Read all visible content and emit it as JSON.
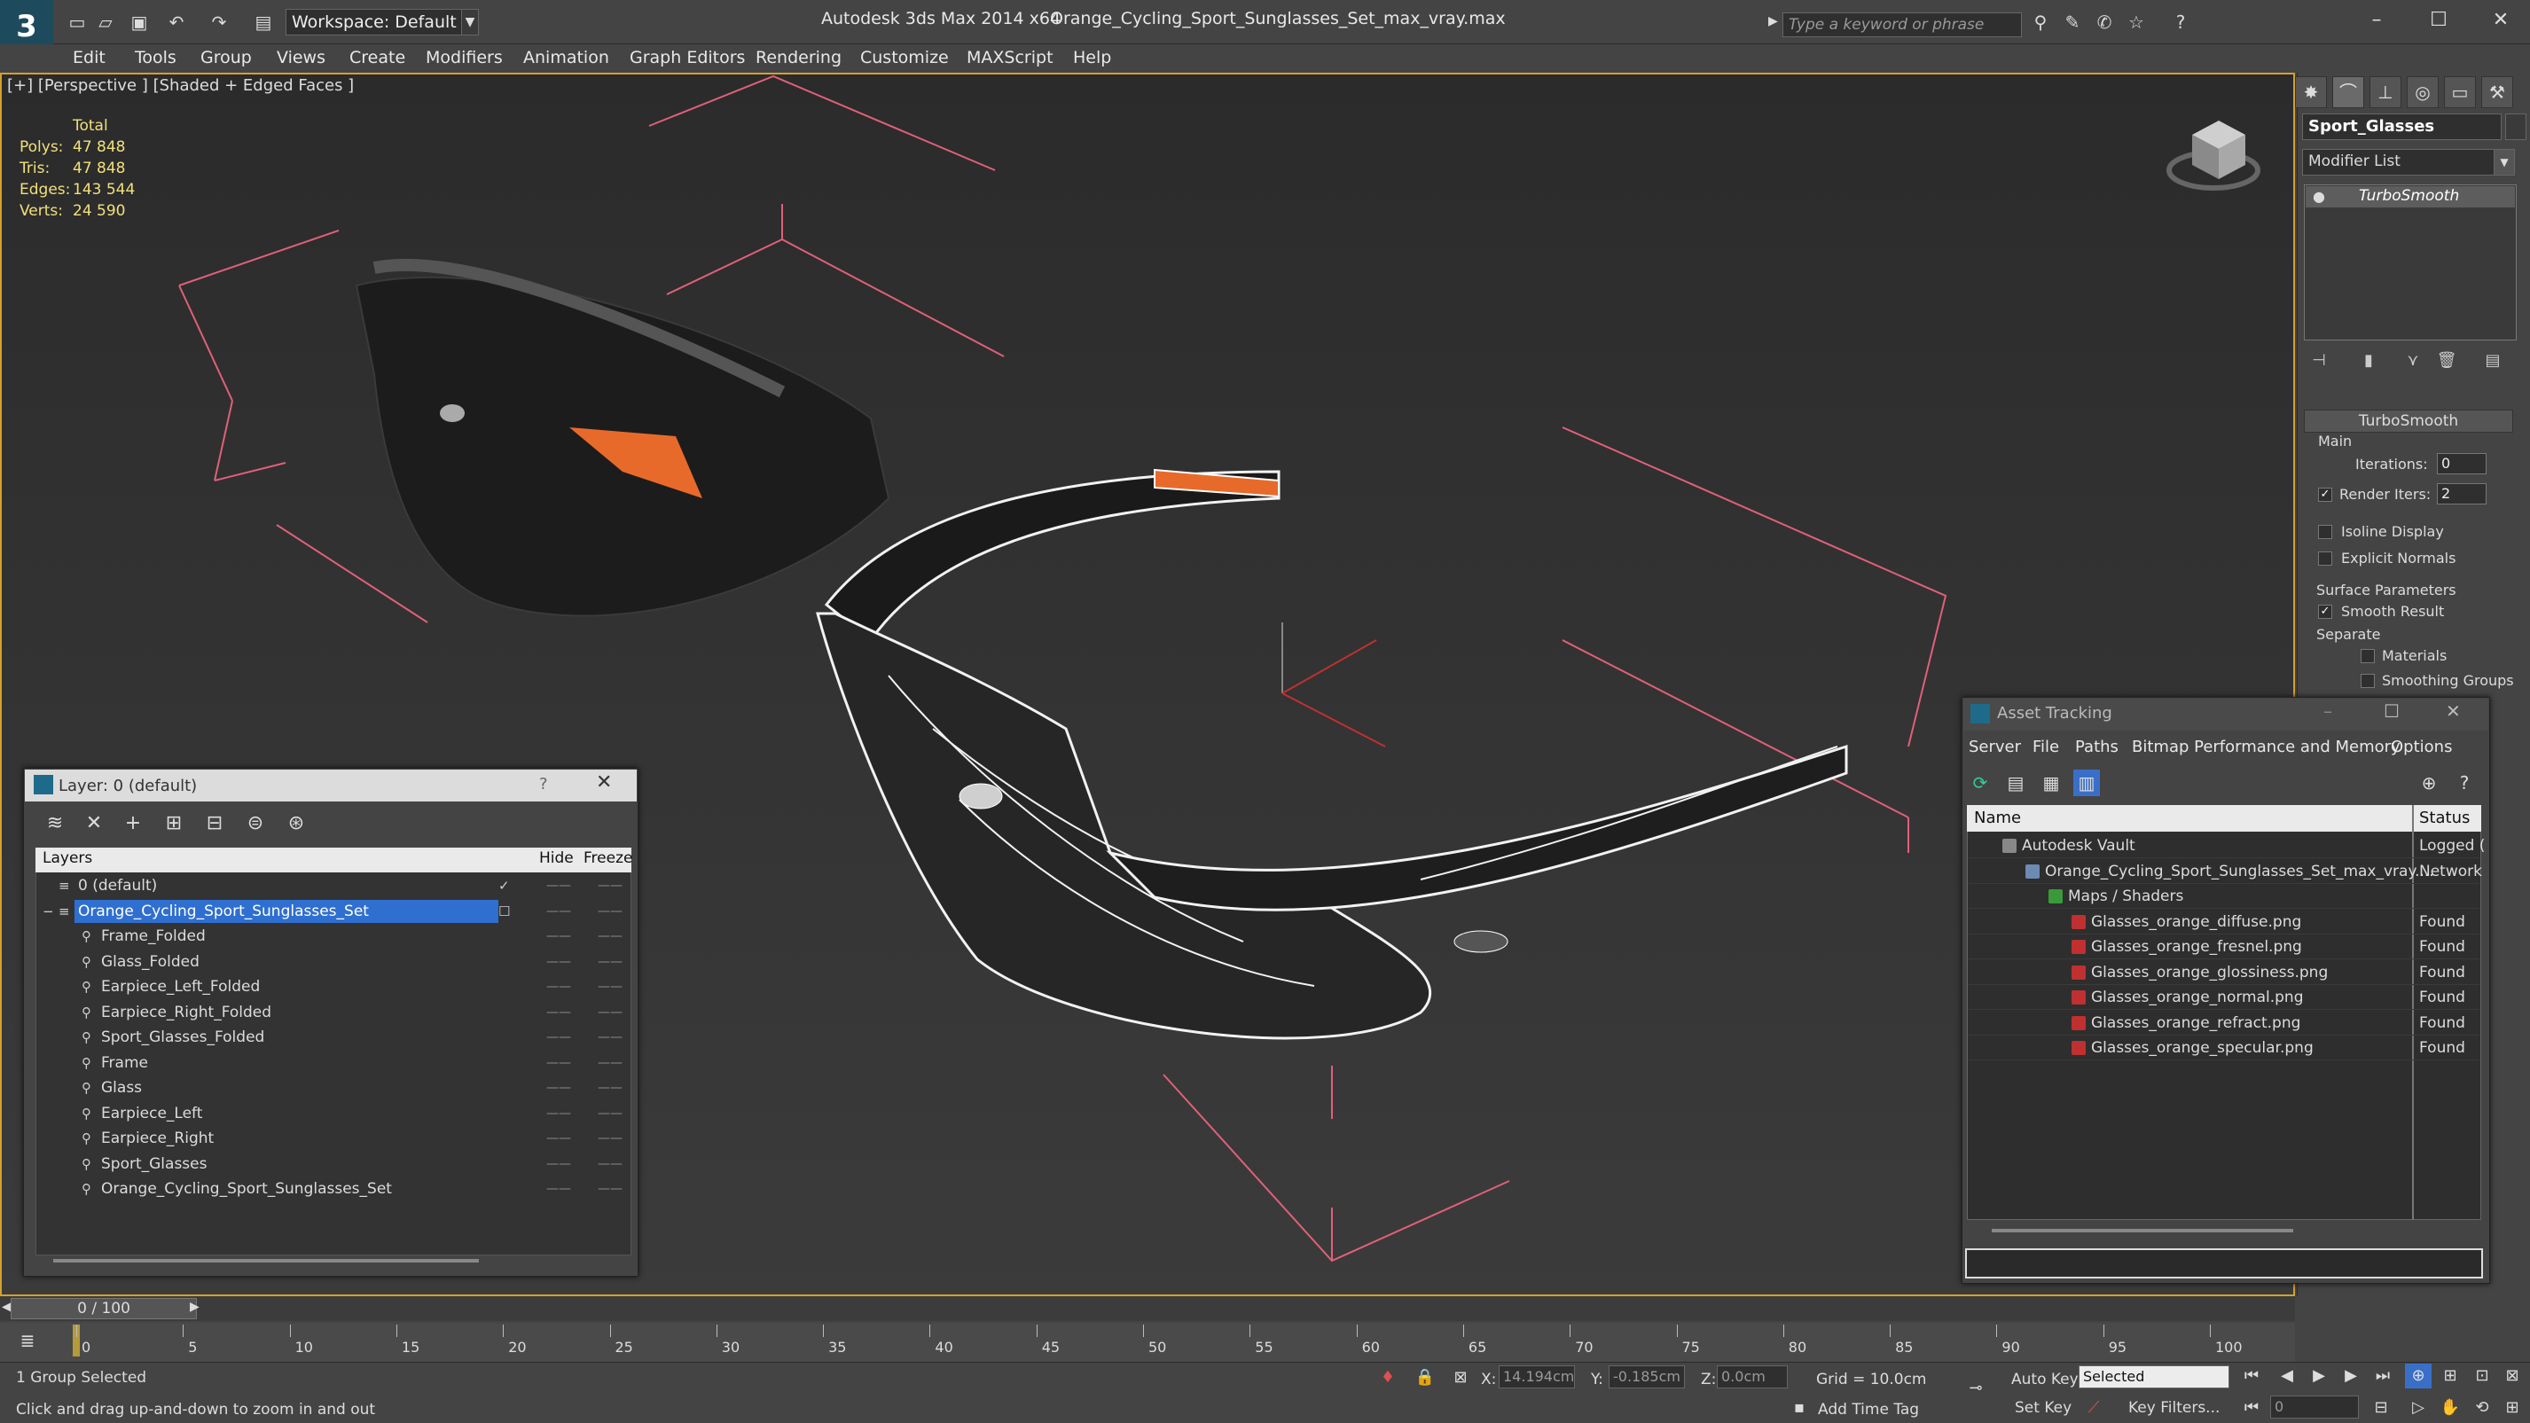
{
  "titlebar": {
    "workspace": "Workspace: Default",
    "app_title": "Autodesk 3ds Max  2014 x64",
    "file_title": "Orange_Cycling_Sport_Sunglasses_Set_max_vray.max",
    "search_placeholder": "Type a keyword or phrase"
  },
  "menu": [
    "Edit",
    "Tools",
    "Group",
    "Views",
    "Create",
    "Modifiers",
    "Animation",
    "Graph Editors",
    "Rendering",
    "Customize",
    "MAXScript",
    "Help"
  ],
  "viewport": {
    "label": "[+] [Perspective ] [Shaded + Edged Faces ]",
    "stats_header": "Total",
    "stats": [
      {
        "label": "Polys:",
        "value": "47 848"
      },
      {
        "label": "Tris:",
        "value": "47 848"
      },
      {
        "label": "Edges:",
        "value": "143 544"
      },
      {
        "label": "Verts:",
        "value": "24 590"
      }
    ]
  },
  "command_panel": {
    "object_name": "Sport_Glasses",
    "modifier_list": "Modifier List",
    "stack_item": "TurboSmooth",
    "rollout_title": "TurboSmooth",
    "main_label": "Main",
    "iterations_label": "Iterations:",
    "iterations_value": "0",
    "render_iters_label": "Render Iters:",
    "render_iters_value": "2",
    "isoline_label": "Isoline Display",
    "explicit_label": "Explicit Normals",
    "surface_label": "Surface Parameters",
    "smooth_label": "Smooth Result",
    "separate_label": "Separate",
    "materials_label": "Materials",
    "smoothing_label": "Smoothing Groups"
  },
  "layer_dialog": {
    "title": "Layer: 0 (default)",
    "help": "?",
    "col_layers": "Layers",
    "col_hide": "Hide",
    "col_freeze": "Freeze",
    "rows": [
      {
        "name": "0 (default)",
        "indent": 0
      },
      {
        "name": "Orange_Cycling_Sport_Sunglasses_Set",
        "indent": 0
      },
      {
        "name": "Frame_Folded",
        "indent": 1
      },
      {
        "name": "Glass_Folded",
        "indent": 1
      },
      {
        "name": "Earpiece_Left_Folded",
        "indent": 1
      },
      {
        "name": "Earpiece_Right_Folded",
        "indent": 1
      },
      {
        "name": "Sport_Glasses_Folded",
        "indent": 1
      },
      {
        "name": "Frame",
        "indent": 1
      },
      {
        "name": "Glass",
        "indent": 1
      },
      {
        "name": "Earpiece_Left",
        "indent": 1
      },
      {
        "name": "Earpiece_Right",
        "indent": 1
      },
      {
        "name": "Sport_Glasses",
        "indent": 1
      },
      {
        "name": "Orange_Cycling_Sport_Sunglasses_Set",
        "indent": 1
      }
    ]
  },
  "asset_dialog": {
    "title": "Asset Tracking",
    "menu": [
      "Server",
      "File",
      "Paths",
      "Bitmap Performance and Memory",
      "Options"
    ],
    "col_name": "Name",
    "col_status": "Status",
    "rows": [
      {
        "name": "Autodesk Vault",
        "status": "Logged (",
        "level": 0
      },
      {
        "name": "Orange_Cycling_Sport_Sunglasses_Set_max_vray....",
        "status": "Network",
        "level": 1
      },
      {
        "name": "Maps / Shaders",
        "status": "",
        "level": 2
      },
      {
        "name": "Glasses_orange_diffuse.png",
        "status": "Found",
        "level": 3
      },
      {
        "name": "Glasses_orange_fresnel.png",
        "status": "Found",
        "level": 3
      },
      {
        "name": "Glasses_orange_glossiness.png",
        "status": "Found",
        "level": 3
      },
      {
        "name": "Glasses_orange_normal.png",
        "status": "Found",
        "level": 3
      },
      {
        "name": "Glasses_orange_refract.png",
        "status": "Found",
        "level": 3
      },
      {
        "name": "Glasses_orange_specular.png",
        "status": "Found",
        "level": 3
      }
    ]
  },
  "timeline": {
    "frame_display": "0 / 100",
    "ticks": [
      "0",
      "5",
      "10",
      "15",
      "20",
      "25",
      "30",
      "35",
      "40",
      "45",
      "50",
      "55",
      "60",
      "65",
      "70",
      "75",
      "80",
      "85",
      "90",
      "95",
      "100"
    ]
  },
  "statusbar": {
    "selection": "1 Group Selected",
    "prompt": "Click and drag up-and-down to zoom in and out",
    "x_label": "X:",
    "x_value": "14.194cm",
    "y_label": "Y:",
    "y_value": "-0.185cm",
    "z_label": "Z:",
    "z_value": "0.0cm",
    "grid": "Grid = 10.0cm",
    "auto_key": "Auto Key",
    "set_key": "Set Key",
    "selected": "Selected",
    "key_filters": "Key Filters...",
    "add_time_tag": "Add Time Tag",
    "frame_field": "0"
  },
  "colors": {
    "viewport_border": "#d4a12a",
    "selection": "#2f6fd0",
    "stats_text": "#f2e07c",
    "bbox_lines": "#e0607a",
    "lens_orange": "#e86a2a"
  }
}
